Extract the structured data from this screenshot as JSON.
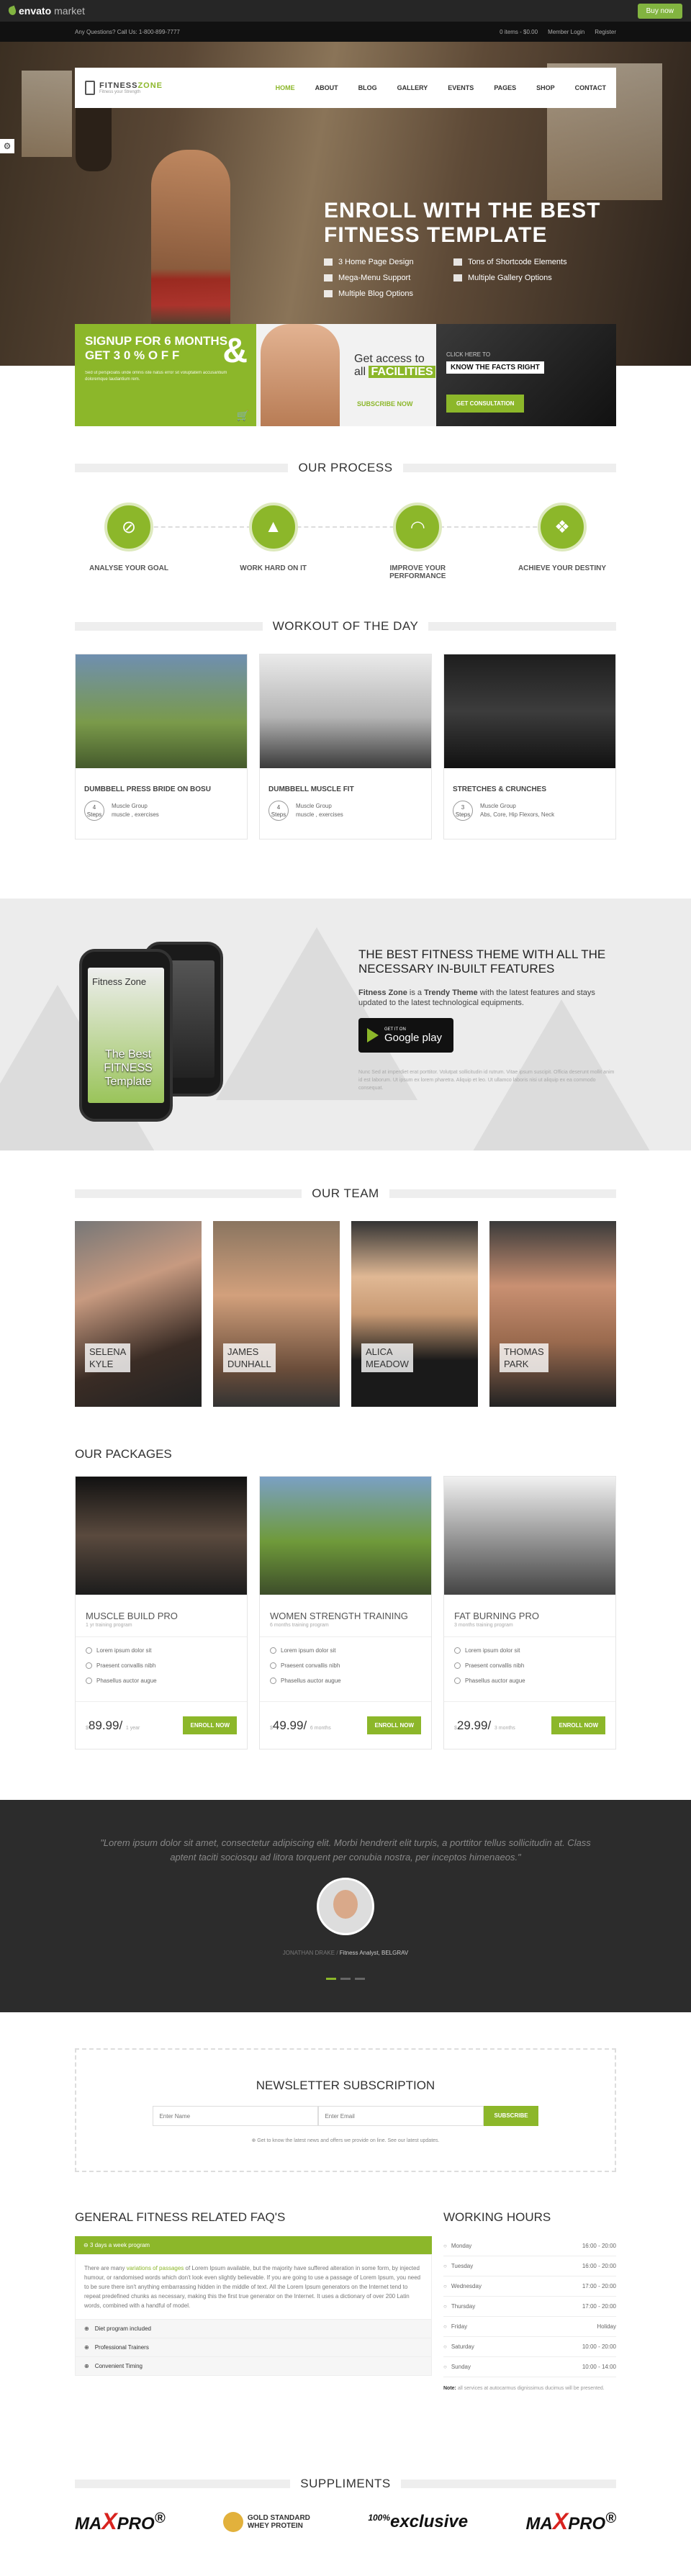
{
  "envato": {
    "logo_main": "envato",
    "logo_sub": "market",
    "buy_label": "Buy now"
  },
  "topbar": {
    "contact": "Any Questions? Call Us: 1-800-899-7777",
    "cart": "0 items - $0.00",
    "login": "Member Login",
    "register": "Register"
  },
  "brand": {
    "name_a": "FITNESS",
    "name_b": "ZONE",
    "tagline": "Fitness your Strength"
  },
  "menu": [
    "HOME",
    "ABOUT",
    "BLOG",
    "GALLERY",
    "EVENTS",
    "PAGES",
    "SHOP",
    "CONTACT"
  ],
  "hero": {
    "title_line1": "ENROLL WITH THE BEST",
    "title_line2": "FITNESS TEMPLATE",
    "features": [
      "3 Home Page Design",
      "Tons of Shortcode Elements",
      "Mega-Menu Support",
      "Multiple Gallery Options",
      "Multiple Blog Options"
    ]
  },
  "promo": {
    "p1_line1": "SIGNUP FOR 6 MONTHS",
    "p1_line2": "GET 3 0 %  O F F",
    "p1_amp": "&",
    "p1_small": "Sed ut perspiciatis unde omnis iste natus error sit voluptatem accusantium doloremque laudantium rem.",
    "p2_get": "Get access to",
    "p2_all": "all",
    "p2_fac": "FACILITIES",
    "p2_sub": "SUBSCRIBE NOW",
    "p3_click": "CLICK HERE TO",
    "p3_know": "KNOW THE FACTS RIGHT",
    "p3_btn": "GET CONSULTATION"
  },
  "process": {
    "title": "OUR PROCESS",
    "steps": [
      {
        "label": "ANALYSE YOUR GOAL",
        "icon": "dumbbell-icon"
      },
      {
        "label": "WORK HARD ON IT",
        "icon": "whistle-icon"
      },
      {
        "label": "IMPROVE YOUR PERFORMANCE",
        "icon": "gauge-icon"
      },
      {
        "label": "ACHIEVE YOUR DESTINY",
        "icon": "trophy-icon"
      }
    ]
  },
  "workout": {
    "title": "WORKOUT OF THE DAY",
    "cards": [
      {
        "title": "DUMBBELL PRESS BRIDE ON BOSU",
        "count": "4",
        "unit": "Steps",
        "group": "Muscle Group",
        "muscles": "muscle , exercises"
      },
      {
        "title": "DUMBBELL MUSCLE FIT",
        "count": "4",
        "unit": "Steps",
        "group": "Muscle Group",
        "muscles": "muscle , exercises"
      },
      {
        "title": "STRETCHES & CRUNCHES",
        "count": "3",
        "unit": "Steps",
        "group": "Muscle Group",
        "muscles": "Abs, Core, Hip Flexors, Neck"
      }
    ]
  },
  "app": {
    "phone_title": "Fitness Zone",
    "phone_text": "The Best FITNESS Template",
    "heading": "THE BEST FITNESS THEME WITH ALL THE NECESSARY IN-BUILT FEATURES",
    "text_a": "Fitness Zone",
    "text_b": " is a ",
    "text_c": "Trendy Theme",
    "text_d": " with the latest features and stays updated to the latest technological equipments.",
    "gplay_small": "GET IT ON",
    "gplay_big": "Google play",
    "fine": "Nunc Sed at imperdiet erat porttitor. Volutpat sollicitudin id rutrum. Vitae ipsum suscipit. Officia deserunt mollit anim id est laborum. Ut ipsum ex lorem pharetra. Aliquip et leo. Ut ullamco laboris nisi ut aliquip ex ea commodo consequat."
  },
  "team": {
    "title": "OUR TEAM",
    "members": [
      {
        "first": "SELENA",
        "last": "KYLE"
      },
      {
        "first": "JAMES",
        "last": "DUNHALL"
      },
      {
        "first": "ALICA",
        "last": "MEADOW"
      },
      {
        "first": "THOMAS",
        "last": "PARK"
      }
    ]
  },
  "packages": {
    "title": "OUR PACKAGES",
    "items": [
      {
        "title": "MUSCLE BUILD PRO",
        "sub": "1 yr training program",
        "features": [
          "Lorem ipsum dolor sit",
          "Praesent convallis nibh",
          "Phasellus auctor augue"
        ],
        "price": "89.99/",
        "period": "1 year",
        "btn": "ENROLL NOW"
      },
      {
        "title": "WOMEN STRENGTH TRAINING",
        "sub": "6 months training program",
        "features": [
          "Lorem ipsum dolor sit",
          "Praesent convallis nibh",
          "Phasellus auctor augue"
        ],
        "price": "49.99/",
        "period": "6 months",
        "btn": "ENROLL NOW"
      },
      {
        "title": "FAT BURNING PRO",
        "sub": "3 months training program",
        "features": [
          "Lorem ipsum dolor sit",
          "Praesent convallis nibh",
          "Phasellus auctor augue"
        ],
        "price": "29.99/",
        "period": "3 months",
        "btn": "ENROLL NOW"
      }
    ],
    "currency": "$"
  },
  "testimonial": {
    "quote": "\"Lorem ipsum dolor sit amet, consectetur adipiscing elit. Morbi hendrerit elit turpis, a porttitor tellus sollicitudin at. Class aptent taciti sociosqu ad litora torquent per conubia nostra, per inceptos himenaeos.\"",
    "author": "JONATHAN DRAKE",
    "role": "Fitness Analyst, BELGRAV"
  },
  "newsletter": {
    "title": "NEWSLETTER SUBSCRIPTION",
    "name_ph": "Enter Name",
    "email_ph": "Enter Email",
    "btn": "SUBSCRIBE",
    "note": "Get to know the latest news and offers we provide on line. See our latest updates."
  },
  "faq": {
    "title": "GENERAL FITNESS RELATED FAQ'S",
    "open_q": "3 days a week program",
    "answer_a": "There are many ",
    "answer_hl": "variations of passages",
    "answer_b": " of Lorem Ipsum available, but the majority have suffered alteration in some form, by injected humour, or randomised words which don't look even slightly believable. If you are going to use a passage of Lorem Ipsum, you need to be sure there isn't anything embarrassing hidden in the middle of text. All the Lorem Ipsum generators on the Internet tend to repeat predefined chunks as necessary, making this the first true generator on the Internet. It uses a dictionary of over 200 Latin words, combined with a handful of model.",
    "items": [
      "Diet program included",
      "Professional Trainers",
      "Convenient Timing"
    ]
  },
  "hours": {
    "title": "WORKING HOURS",
    "rows": [
      {
        "day": "Monday",
        "time": "16:00 - 20:00"
      },
      {
        "day": "Tuesday",
        "time": "16:00 - 20:00"
      },
      {
        "day": "Wednesday",
        "time": "17:00 - 20:00"
      },
      {
        "day": "Thursday",
        "time": "17:00 - 20:00"
      },
      {
        "day": "Friday",
        "time": "Holiday"
      },
      {
        "day": "Saturday",
        "time": "10:00 - 20:00"
      },
      {
        "day": "Sunday",
        "time": "10:00 - 14:00"
      }
    ],
    "note_b": "Note:",
    "note": " all services at autocarmus dignissimus ducimus will be presented."
  },
  "supplements": {
    "title": "SUPPLIMENTS",
    "logos": [
      {
        "a": "MA",
        "x": "X",
        "b": "PRO",
        "sup": "®"
      },
      {
        "gs1": "GOLD STANDARD",
        "gs2": "WHEY PROTEIN"
      },
      {
        "text": "exclusive",
        "num": "100%"
      },
      {
        "a": "MA",
        "x": "X",
        "b": "PRO",
        "sup": "®"
      }
    ]
  },
  "colors": {
    "accent": "#8cb72a",
    "dark": "#2c2c2c",
    "envato_green": "#82b440"
  }
}
